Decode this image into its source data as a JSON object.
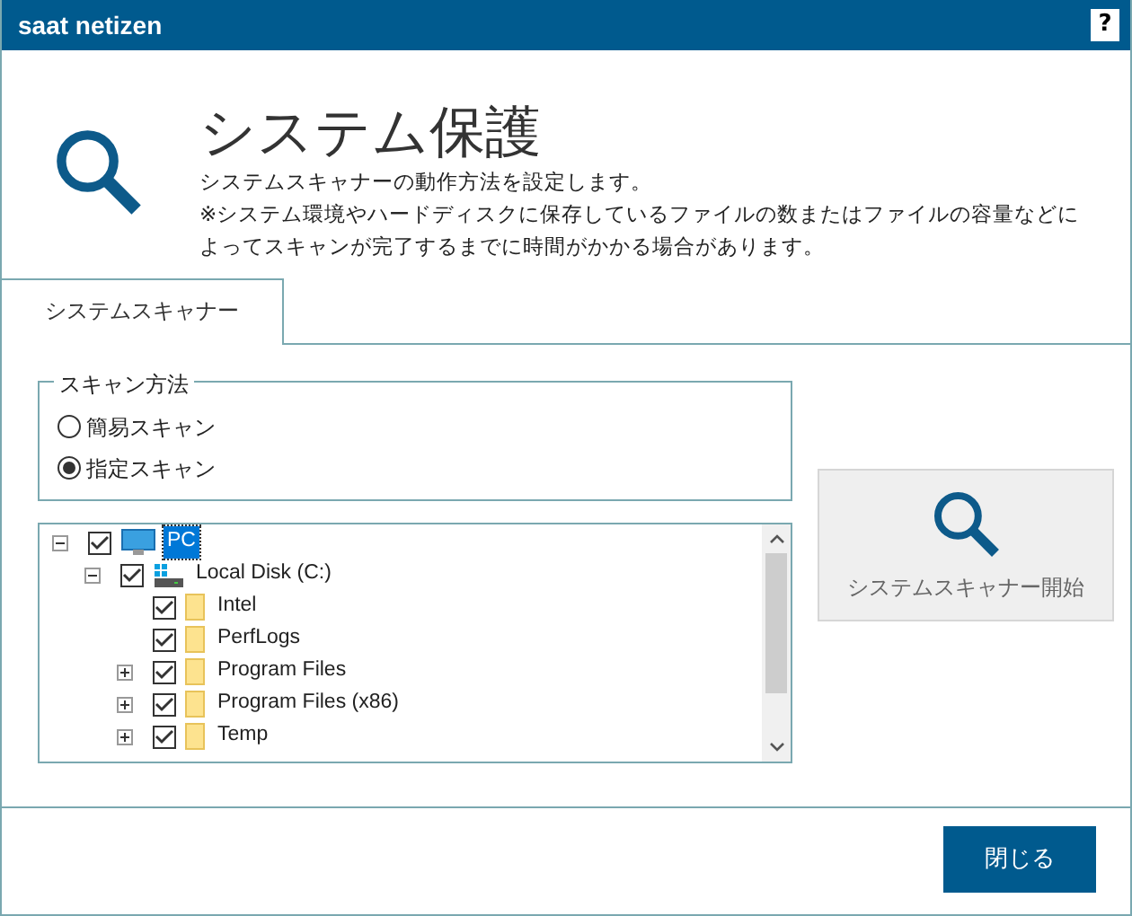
{
  "window": {
    "title": "saat netizen",
    "help": "?"
  },
  "header": {
    "title": "システム保護",
    "description": "システムスキャナーの動作方法を設定します。",
    "note": "※システム環境やハードディスクに保存しているファイルの数またはファイルの容量などによってスキャンが完了するまでに時間がかかる場合があります。"
  },
  "tabs": [
    {
      "label": "システムスキャナー",
      "selected": true
    }
  ],
  "scan_method": {
    "legend": "スキャン方法",
    "options": [
      {
        "label": "簡易スキャン",
        "selected": false
      },
      {
        "label": "指定スキャン",
        "selected": true
      }
    ]
  },
  "tree": [
    {
      "label": "PC",
      "kind": "computer",
      "checked": true,
      "expanded": true,
      "selected": true,
      "children": [
        {
          "label": "Local Disk (C:)",
          "kind": "drive",
          "checked": true,
          "expanded": true,
          "selected": false,
          "children": [
            {
              "label": "Intel",
              "kind": "folder",
              "checked": true,
              "selected": false
            },
            {
              "label": "PerfLogs",
              "kind": "folder",
              "checked": true,
              "selected": false
            },
            {
              "label": "Program Files",
              "kind": "folder",
              "checked": true,
              "expanded": false,
              "selected": false
            },
            {
              "label": "Program Files (x86)",
              "kind": "folder",
              "checked": true,
              "expanded": false,
              "selected": false
            },
            {
              "label": "Temp",
              "kind": "folder",
              "checked": true,
              "expanded": false,
              "selected": false
            }
          ]
        }
      ]
    }
  ],
  "start_button": {
    "label": "システムスキャナー開始"
  },
  "buttons": [
    {
      "label": "閉じる"
    }
  ]
}
